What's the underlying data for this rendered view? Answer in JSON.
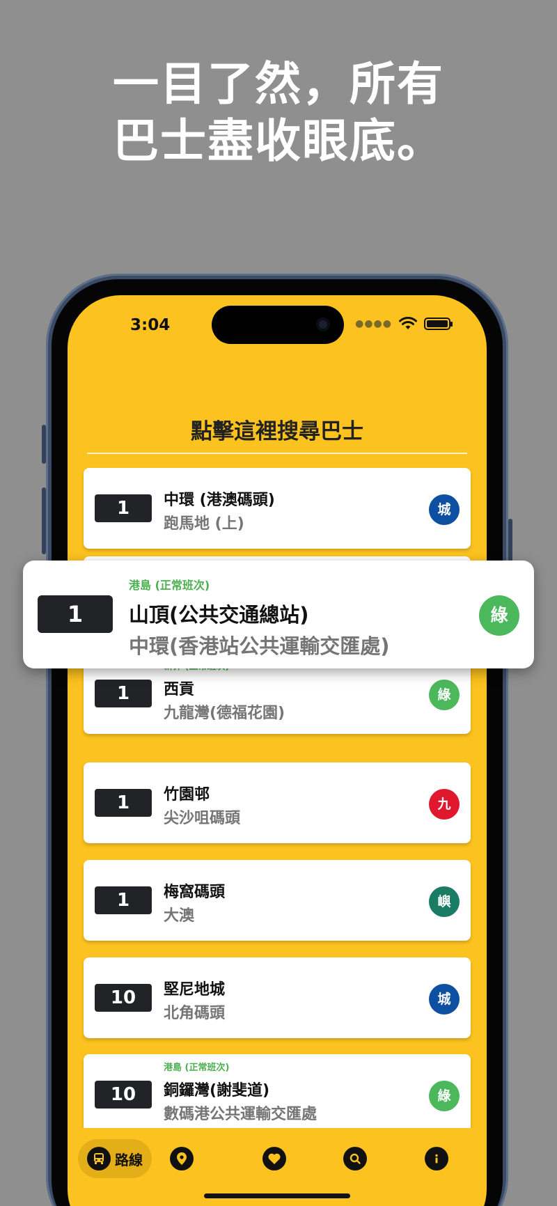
{
  "headline": {
    "line1": "一目了然，所有",
    "line2": "巴士盡收眼底。"
  },
  "status_bar": {
    "time": "3:04"
  },
  "search": {
    "title": "點擊這裡搜尋巴士"
  },
  "routes": [
    {
      "number": "1",
      "destination": "中環 (港澳碼頭)",
      "origin": "跑馬地 (上)",
      "service": "",
      "company": "城",
      "company_color": "#0d4fa1"
    },
    {
      "number": "1",
      "destination": "西貢",
      "origin": "九龍灣(德福花園)",
      "service": "新界 (正常班次)",
      "company": "綠",
      "company_color": "#4cb85c"
    },
    {
      "number": "1",
      "destination": "竹園邨",
      "origin": "尖沙咀碼頭",
      "service": "",
      "company": "九",
      "company_color": "#e0182d"
    },
    {
      "number": "1",
      "destination": "梅窩碼頭",
      "origin": "大澳",
      "service": "",
      "company": "嶼",
      "company_color": "#1b7c66"
    },
    {
      "number": "10",
      "destination": "堅尼地城",
      "origin": "北角碼頭",
      "service": "",
      "company": "城",
      "company_color": "#0d4fa1"
    },
    {
      "number": "10",
      "destination": "銅鑼灣(謝斐道)",
      "origin": "數碼港公共運輸交匯處",
      "service": "港島 (正常班次)",
      "company": "綠",
      "company_color": "#4cb85c"
    }
  ],
  "highlight_route": {
    "number": "1",
    "destination": "山頂(公共交通總站)",
    "origin": "中環(香港站公共運輸交匯處)",
    "service": "港島 (正常班次)",
    "company": "綠",
    "company_color": "#4cb85c"
  },
  "nav": {
    "routes_label": "路線",
    "items": [
      "bus-icon",
      "location-pin-icon",
      "heart-icon",
      "search-icon",
      "info-icon"
    ]
  },
  "colors": {
    "background": "#8f8f8f",
    "screen": "#fcc21f",
    "service_green": "#4caf50"
  }
}
